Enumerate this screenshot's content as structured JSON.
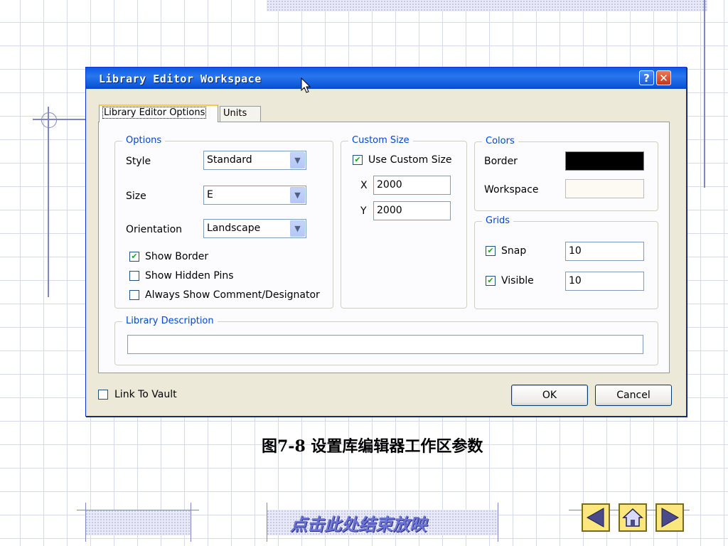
{
  "dialog": {
    "title": "Library Editor Workspace",
    "help_label": "?",
    "close_label": "✕",
    "tabs": [
      {
        "label": "Library Editor Options",
        "active": true
      },
      {
        "label": "Units",
        "active": false
      }
    ],
    "options": {
      "legend": "Options",
      "style_label": "Style",
      "style_value": "Standard",
      "size_label": "Size",
      "size_value": "E",
      "orientation_label": "Orientation",
      "orientation_value": "Landscape",
      "show_border": {
        "label": "Show Border",
        "checked": true
      },
      "show_hidden_pins": {
        "label": "Show Hidden Pins",
        "checked": false
      },
      "always_show_comment": {
        "label": "Always Show Comment/Designator",
        "checked": false
      }
    },
    "custom_size": {
      "legend": "Custom Size",
      "use_custom": {
        "label": "Use Custom Size",
        "checked": true
      },
      "x_label": "X",
      "x_value": "2000",
      "y_label": "Y",
      "y_value": "2000"
    },
    "colors": {
      "legend": "Colors",
      "border_label": "Border",
      "border_color": "#000000",
      "workspace_label": "Workspace",
      "workspace_color": "#fdfaf4"
    },
    "grids": {
      "legend": "Grids",
      "snap": {
        "label": "Snap",
        "checked": true,
        "value": "10"
      },
      "visible": {
        "label": "Visible",
        "checked": true,
        "value": "10"
      }
    },
    "library_description": {
      "legend": "Library Description",
      "value": ""
    },
    "link_to_vault": {
      "label": "Link To Vault",
      "checked": false
    },
    "ok_label": "OK",
    "cancel_label": "Cancel"
  },
  "caption": "图7-8  设置库编辑器工作区参数",
  "footer": {
    "end_show": "点击此处结束放映"
  },
  "icons": {
    "check": "✔",
    "chevron": "▼"
  },
  "colors": {
    "titlebar": "#0a5be2",
    "accent_text": "#0046d5",
    "nav_button": "#fce77e"
  }
}
